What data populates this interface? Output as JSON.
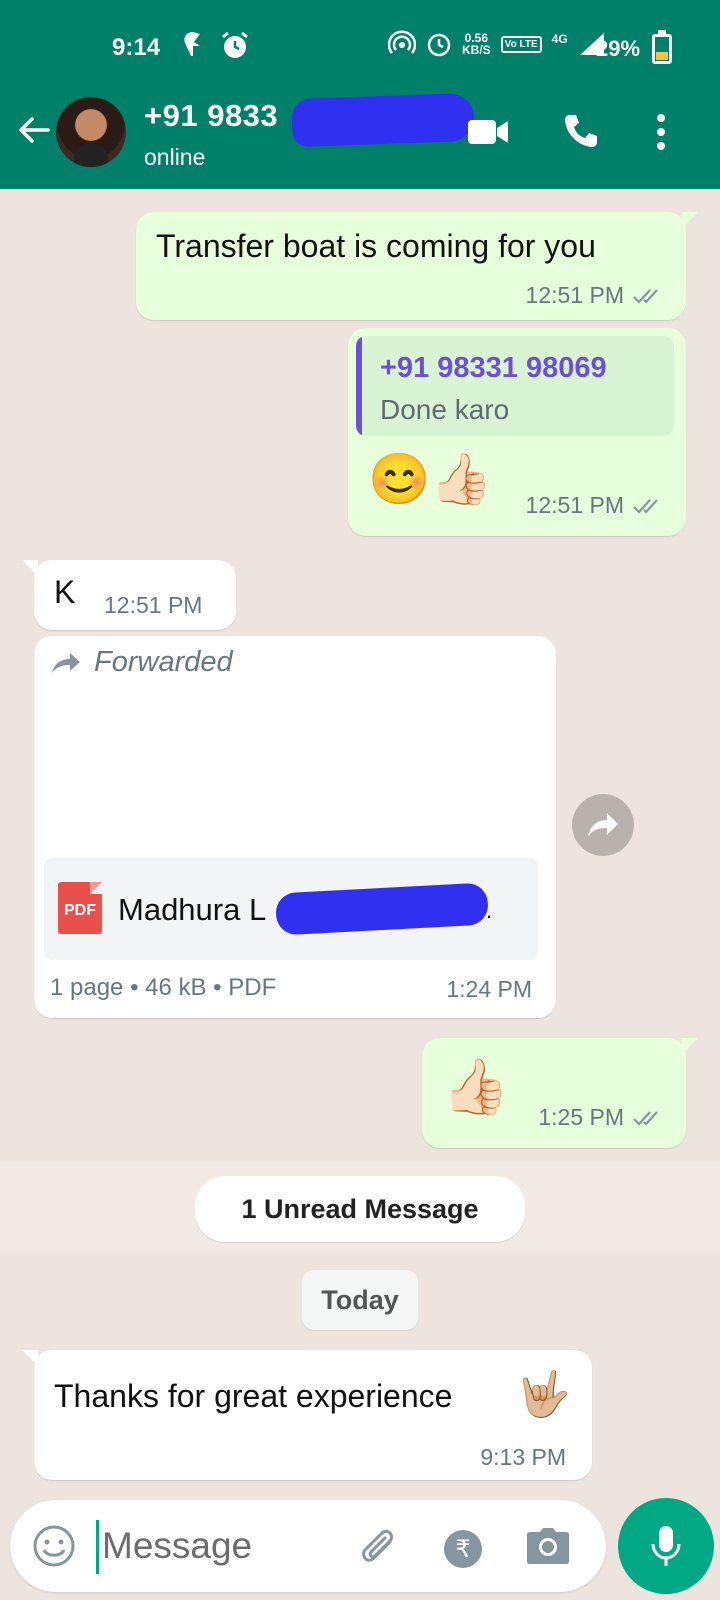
{
  "status_bar": {
    "time": "9:14",
    "net_speed_value": "0.56",
    "net_speed_unit": "KB/S",
    "volte": "Vo LTE",
    "network": "4G",
    "battery": "29%"
  },
  "header": {
    "contact_name": "+91 9833",
    "status": "online"
  },
  "messages": {
    "m1": {
      "text": "Transfer boat is coming for you",
      "time": "12:51 PM"
    },
    "m2": {
      "quote_name": "+91 98331 98069",
      "quote_text": "Done karo",
      "emojis": "😊👍🏻",
      "time": "12:51 PM"
    },
    "m3": {
      "text": "K",
      "time": "12:51 PM"
    },
    "m4": {
      "forwarded_label": "Forwarded",
      "pdf_badge": "PDF",
      "doc_name": "Madhura L",
      "doc_suffix": ".",
      "doc_info": "1 page • 46 kB • PDF",
      "time": "1:24 PM"
    },
    "m5": {
      "emoji": "👍🏻",
      "time": "1:25 PM"
    },
    "m6": {
      "text": "Thanks for great experience",
      "emoji": "🤟🏼",
      "time": "9:13 PM"
    }
  },
  "unread_label": "1 Unread Message",
  "date_label": "Today",
  "composer": {
    "placeholder": "Message"
  },
  "colors": {
    "header": "#008069",
    "outgoing_bubble": "#e7ffdb",
    "incoming_bubble": "#ffffff",
    "accent": "#00a884",
    "quote_accent": "#6b50d8"
  }
}
